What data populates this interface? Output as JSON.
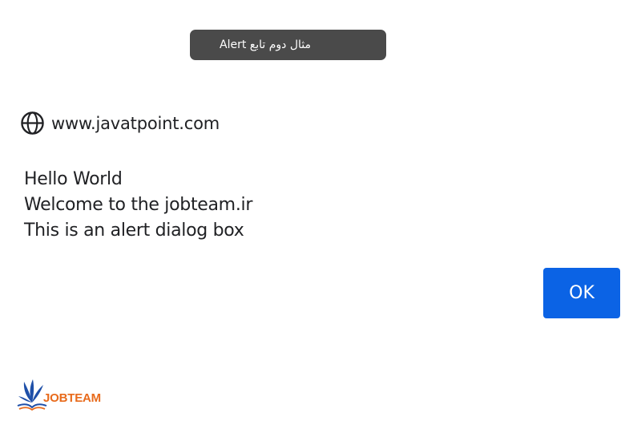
{
  "caption": {
    "text": "مثال دوم تابع Alert"
  },
  "dialog": {
    "origin_icon": "globe-icon",
    "origin": "www.javatpoint.com",
    "message_lines": [
      "Hello World",
      "Welcome to the jobteam.ir",
      "This is an alert dialog box"
    ],
    "ok_label": "OK",
    "ok_color": "#0b63e5"
  },
  "watermark": {
    "text": "JOBTEAM",
    "brand_color": "#e86a1b",
    "mark_color": "#1e4fa8"
  }
}
